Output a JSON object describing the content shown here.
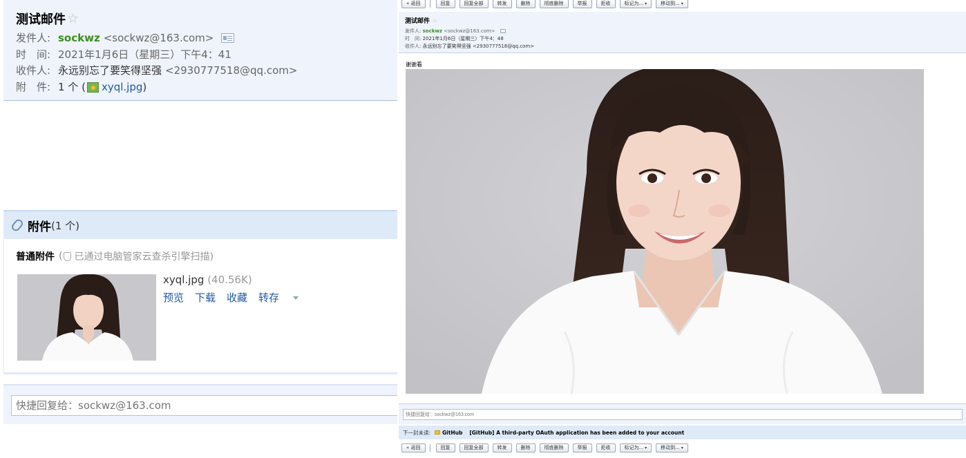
{
  "left": {
    "header": {
      "title": "测试邮件",
      "star": "☆",
      "from_label": "发件人:",
      "from_name": "sockwz",
      "from_addr": "<sockwz@163.com>",
      "time_label": "时　间:",
      "time_value": "2021年1月6日（星期三）下午4：41",
      "to_label": "收件人:",
      "to_value": "永远别忘了要笑得坚强",
      "to_addr": "<2930777518@qq.com>",
      "att_label": "附　件:",
      "att_count": "1 个 (",
      "att_file": "xyql.jpg",
      "att_close": ")"
    },
    "attachments": {
      "title": "附件",
      "count": "(1 个)",
      "section": "普通附件",
      "scan_prefix": "(",
      "scan_note": "已通过电脑管家云查杀引擎扫描)",
      "file_name": "xyql.jpg",
      "file_size": "(40.56K)",
      "actions": [
        "预览",
        "下载",
        "收藏",
        "转存"
      ]
    },
    "quick_reply_placeholder": "快捷回复给：sockwz@163.com"
  },
  "right": {
    "toolbar": [
      "« 返回",
      "回复",
      "回复全部",
      "转发",
      "删除",
      "彻底删除",
      "举报",
      "拒收",
      "标记为...",
      "移动到..."
    ],
    "header": {
      "title": "测试邮件",
      "star": "☆",
      "from_label": "发件人:",
      "from_name": "sockwz",
      "from_addr": "<sockwz@163.com>",
      "time_label": "时　间:",
      "time_value": "2021年1月6日（星期三）下午4：48",
      "to_label": "收件人:",
      "to_value": "永远别忘了要笑得坚强 <2930777518@qq.com>"
    },
    "body_text": "谢谢看",
    "quick_reply_placeholder": "快捷回复给：sockwz@163.com",
    "next_mail": {
      "label": "下一封未读:",
      "from": "GitHub",
      "subject": "[GitHub] A third-party OAuth application has been added to your account"
    }
  },
  "colors": {
    "header_bg": "#eef3fc",
    "sender_green": "#3b8e1f",
    "link_blue": "#1e5aa6"
  }
}
